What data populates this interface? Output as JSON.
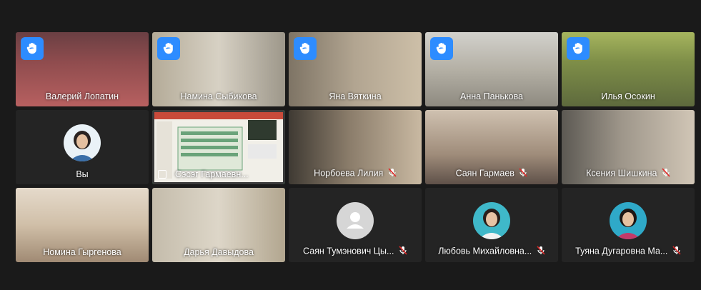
{
  "participants": [
    {
      "name": "Валерий Лопатин",
      "hand_raised": true,
      "muted": false,
      "type": "video",
      "bg": "#8a4a4a"
    },
    {
      "name": "Намина Сыбикова",
      "hand_raised": true,
      "muted": false,
      "type": "video",
      "bg": "#c9c1b2"
    },
    {
      "name": "Яна Вяткина",
      "hand_raised": true,
      "muted": false,
      "type": "video",
      "bg": "#a89a86"
    },
    {
      "name": "Анна Панькова",
      "hand_raised": true,
      "muted": false,
      "type": "video",
      "bg": "#b9b6ab"
    },
    {
      "name": "Илья Осокин",
      "hand_raised": true,
      "muted": false,
      "type": "video",
      "bg": "#8fa05a"
    },
    {
      "name": "Вы",
      "hand_raised": false,
      "muted": false,
      "type": "avatar",
      "bg": "#242424"
    },
    {
      "name": "Сэсэг Гармаевн...",
      "hand_raised": false,
      "muted": false,
      "type": "screen",
      "bg": "#e9e5dc",
      "active": true
    },
    {
      "name": "Норбоева Лилия",
      "hand_raised": false,
      "muted": true,
      "type": "video",
      "bg": "#8c7e6f"
    },
    {
      "name": "Саян Гармаев",
      "hand_raised": false,
      "muted": true,
      "type": "video",
      "bg": "#b5a493"
    },
    {
      "name": "Ксения Шишкина",
      "hand_raised": false,
      "muted": true,
      "type": "video",
      "bg": "#8c8478"
    },
    {
      "name": "Номина Гыргенова",
      "hand_raised": false,
      "muted": false,
      "type": "video",
      "bg": "#d8ccbe"
    },
    {
      "name": "Дарья Давыдова",
      "hand_raised": false,
      "muted": false,
      "type": "video",
      "bg": "#cfc7b8"
    },
    {
      "name": "Саян Тумэнович Цы...",
      "hand_raised": false,
      "muted": true,
      "type": "generic",
      "bg": "#242424"
    },
    {
      "name": "Любовь Михайловна...",
      "hand_raised": false,
      "muted": true,
      "type": "avatar",
      "bg": "#242424"
    },
    {
      "name": "Туяна Дугаровна Ма...",
      "hand_raised": false,
      "muted": true,
      "type": "avatar",
      "bg": "#242424"
    }
  ],
  "colors": {
    "background": "#1a1a1a",
    "tile": "#242424",
    "hand_badge": "#2d8cff",
    "active_speaker": "#23d959"
  },
  "icons": {
    "hand": "raised-hand-icon",
    "mic": "muted-mic-icon",
    "placeholder": "person-placeholder-icon"
  }
}
